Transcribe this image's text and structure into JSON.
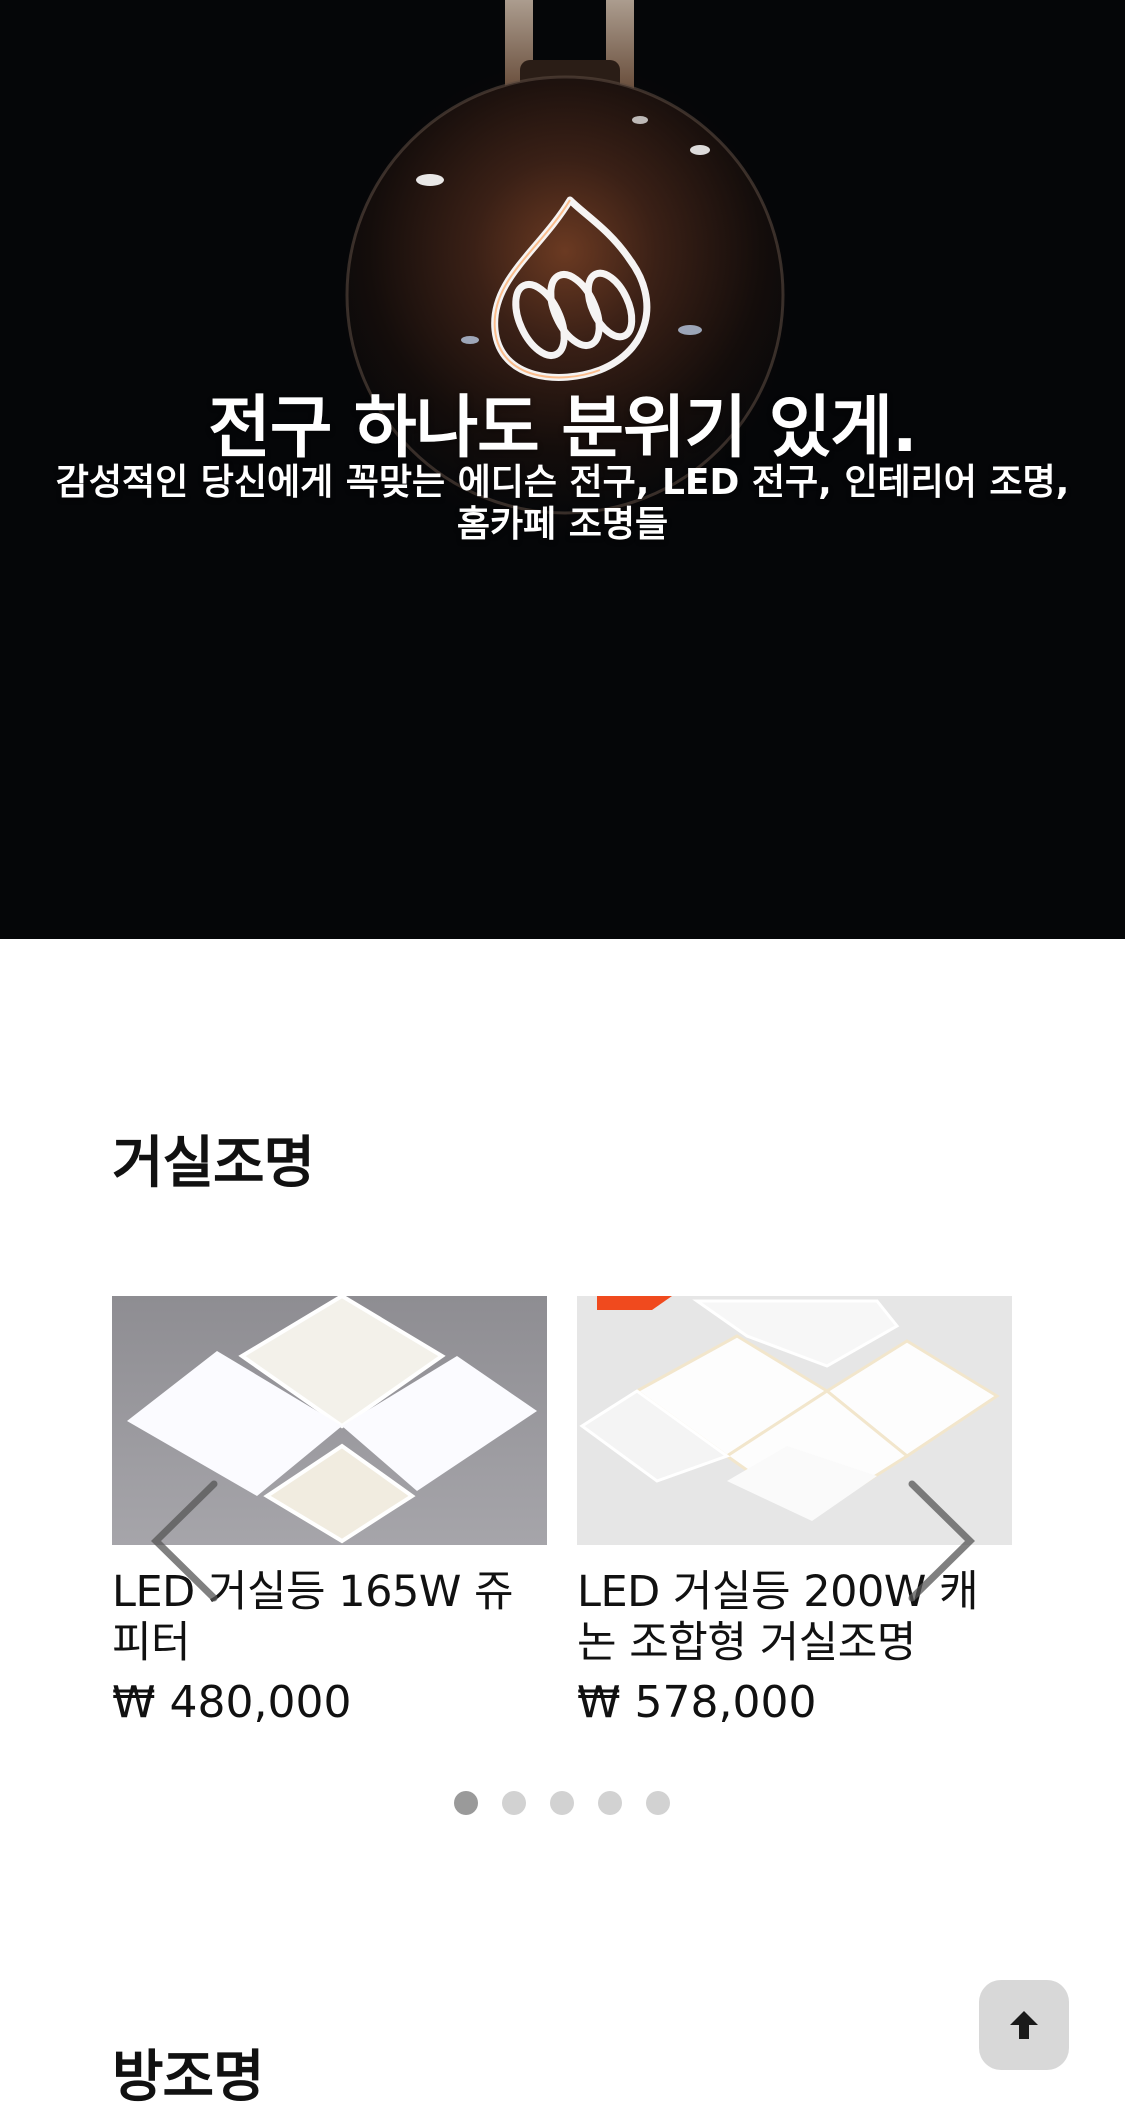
{
  "hero": {
    "title": "전구 하나도 분위기 있게.",
    "subtitle": "감성적인 당신에게 꼭맞는 에디슨 전구, LED 전구, 인테리어 조명, 홈카페 조명들"
  },
  "sections": [
    {
      "title": "거실조명",
      "products": [
        {
          "name": "LED 거실등 165W 쥬피터",
          "price": "₩ 480,000"
        },
        {
          "name": "LED 거실등 200W 캐논 조합형 거실조명",
          "price": "₩ 578,000"
        }
      ],
      "carousel": {
        "slide_count": 5,
        "active_index": 0
      }
    },
    {
      "title": "방조명"
    }
  ],
  "icons": {
    "prev": "chevron-left-icon",
    "next": "chevron-right-icon",
    "scroll_top": "arrow-up-icon"
  },
  "colors": {
    "hero_background": "#050608",
    "dot_active": "#9a9a9a",
    "dot_inactive": "#d2d2d2",
    "top_button": "#d8d8d8"
  }
}
